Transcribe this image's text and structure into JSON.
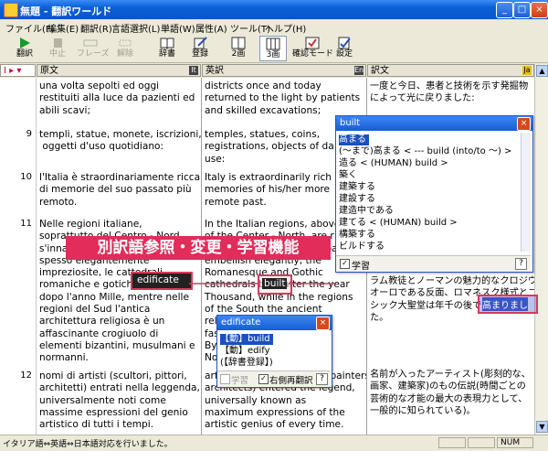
{
  "window": {
    "title": "無題 - 翻訳ワールド",
    "btn_min": "_",
    "btn_max": "□",
    "btn_close": "×"
  },
  "menu": [
    "ファイル(F)",
    "編集(E)",
    "翻訳(R)",
    "言語選択(L)",
    "単語(W)",
    "属性(A)",
    "ツール(T)",
    "ヘルプ(H)"
  ],
  "toolbar": [
    {
      "label": "翻訳",
      "icon": "play-icon",
      "enabled": true
    },
    {
      "label": "中止",
      "icon": "stop-icon",
      "enabled": false
    },
    {
      "label": "フレーズ",
      "icon": "phrase-icon",
      "enabled": false
    },
    {
      "label": "解除",
      "icon": "release-icon",
      "enabled": false
    },
    {
      "label": "辞書",
      "icon": "dictionary-icon",
      "enabled": true
    },
    {
      "label": "登録",
      "icon": "register-icon",
      "enabled": true
    },
    {
      "label": "2画",
      "icon": "two-pane-icon",
      "enabled": true
    },
    {
      "label": "3画",
      "icon": "three-pane-icon",
      "enabled": true
    },
    {
      "label": "確認モード",
      "icon": "check-mode-icon",
      "enabled": true
    },
    {
      "label": "設定",
      "icon": "settings-icon",
      "enabled": true
    }
  ],
  "columns": {
    "source": "原文",
    "english": "英訳",
    "japanese": "訳文",
    "lang_indicator": "I ▸ ▾"
  },
  "line_numbers": [
    "9",
    "10",
    "11",
    "12"
  ],
  "source_paras": [
    "una volta sepolti ed oggi\nrestituiti alla luce da pazienti ed\nabili scavi;",
    "templi, statue, monete, iscrizioni,\n oggetti d'uso quotidiano:",
    "l'Italia è straordinariamente ricca\ndi memorie del suo passato più\nremoto.",
    "Nelle regioni italiane,\nsoprattutto del Centro - Nord\ns'innalzano an\nspesso elegantemente\nimpreziosite, le cattedrali\nromaniche e gotiche edificate\ndopo l'anno Mille, mentre nelle\nregioni del Sud l'antica\narchitettura religiosa è un\naffascinante crogiuolo di\nelementi bizantini, musulmani e\nnormanni.",
    "nomi di artisti (scultori, pittori,\narchitetti) entrati nella leggenda,\nuniversalmente noti come\nmassime espressioni del genio\nartistico di tutti i tempi."
  ],
  "english_paras": [
    "districts once and today\nreturned to the light by patients\nand skilled excavations;",
    "temples, statues, coins,\nregistrations, objects of da\nuse:",
    "Italy is extraordinarily rich o\nmemories of his/her more\nremote past.",
    "In the Italian regions, above\nof the Center - North, are r\nfrequently churches and ba\nembellish elegantly, the\nRomanesque and Gothic\ncathedrals built after the year\nThousand, while in the regions\nof the South the ancient\nreligious architecture is a\nfascinating crucible of\nByzantine, Moslem and\nNorman elements.",
    "artists' names (sculptors, painters,\narchitects) entered the legend,\nuniversally known as\nmaximum expressions of the\nartistic genius of every time."
  ],
  "japanese_paras": [
    "一度と今日、患者と技術を示す発掘物\nによって光に戻りました:",
    "ラム教徒とノーマンの魅力的なクロジウ\nオーロである反面、ロマネスク様式とゴ\nシック大聖堂は年千の後で高まりまし\nた。",
    "名前が入ったアーティスト(彫刻的な、\n画家、建築家)のもの伝説(時間ごとの\n芸術的な才能の最大の表現力として、\n一般的に知られている)。"
  ],
  "popup_build": {
    "title": "built",
    "items": [
      "高まる",
      "(〜まで)高まる < --- build (into/to 〜) >",
      "造る < (HUMAN) build >",
      "築く",
      "建築する",
      "建設する",
      "建造中である",
      "建てる < (HUMAN) build >",
      "構築する",
      "ビルドする"
    ],
    "checkbox_label": "学習",
    "help": "?"
  },
  "popup_edificate": {
    "title": "edificate",
    "items": [
      "【動】build",
      "【動】edify",
      "(【辞書登録】)"
    ],
    "learn_label": "学習",
    "retranslate_label": "右側再翻訳",
    "help": "?"
  },
  "callout": "別訳語参照・変更・学習機能",
  "highlights": {
    "source_word": "edificate",
    "english_word": "built",
    "jp_word": "高まりまし"
  },
  "status": {
    "text": "イタリア語⇔英語⇔日本語対応を行いました。",
    "num": "NUM"
  }
}
